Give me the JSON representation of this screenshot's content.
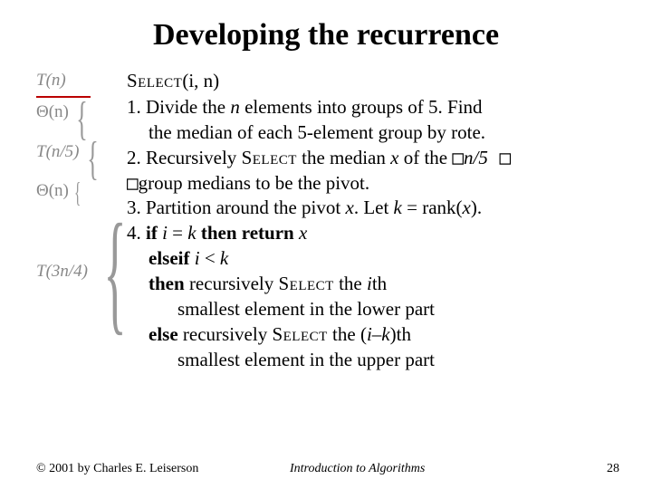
{
  "title": "Developing the recurrence",
  "left": {
    "tn": "T(n)",
    "theta_n": "Θ(n)",
    "tn5": "T(n/5)",
    "theta_n2": "Θ(n)",
    "t3n4": "T(3n/4)"
  },
  "algo": {
    "select_word": "Select",
    "select_args": "(i, n)",
    "step1_a": "1. Divide the ",
    "step1_n": "n",
    "step1_b": " elements into groups of 5. Find",
    "step1_c": "the median of each 5-element group by rote.",
    "step2_a": "2. Recursively ",
    "step2_select": "Select",
    "step2_b": " the median ",
    "step2_x": "x",
    "step2_c": " of the ",
    "step2_sq1": "□",
    "step2_n5": "n/5",
    "step2_sq2": " □",
    "step2_d_sq": "□",
    "step2_d": "group medians to be the pivot.",
    "step3_a": "3. Partition around the pivot ",
    "step3_x": "x",
    "step3_b": ". Let ",
    "step3_k": "k",
    "step3_c": " = rank(",
    "step3_x2": "x",
    "step3_d": ").",
    "step4_a": "4.  ",
    "step4_if": "if ",
    "step4_eq_i": "i",
    "step4_eq_mid": " = ",
    "step4_eq_k": "k",
    "step4_then_return": " then return ",
    "step4_x": "x",
    "elseif": "elseif ",
    "elseif_i": "i",
    "elseif_lt": " < ",
    "elseif_k": "k",
    "then_rec_a": "then ",
    "then_rec_b": "recursively ",
    "then_rec_select": "Select",
    "then_rec_c": " the ",
    "then_rec_i": "i",
    "then_rec_d": "th",
    "then_small": "smallest element in the lower part",
    "else_rec_a": "else ",
    "else_rec_b": "recursively ",
    "else_rec_select": "Select",
    "else_rec_c": " the (",
    "else_rec_i": "i",
    "else_rec_dash": "–",
    "else_rec_k": "k",
    "else_rec_d": ")th",
    "else_small": "smallest element in the upper part"
  },
  "footer": {
    "copyright": "© 2001 by Charles E. Leiserson",
    "book": "Introduction to Algorithms",
    "page": "28"
  }
}
